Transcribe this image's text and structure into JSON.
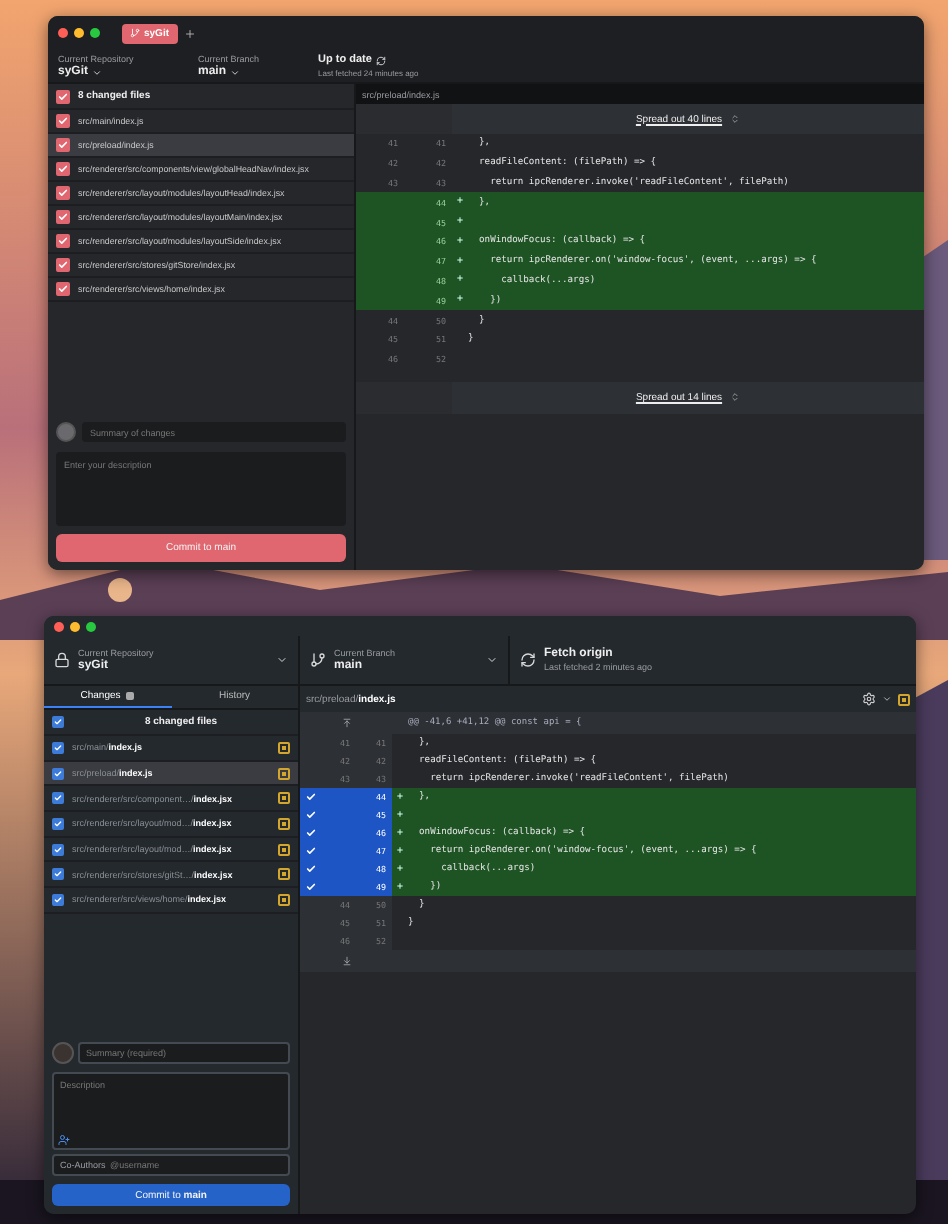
{
  "top_window": {
    "tab": {
      "label": "syGit"
    },
    "toolbar": [
      {
        "kind": "dropdown",
        "label": "Current Repository",
        "value": "syGit"
      },
      {
        "kind": "dropdown",
        "label": "Current Branch",
        "value": "main"
      },
      {
        "kind": "fetch",
        "label": "Up to date",
        "value": "Last fetched 24 minutes ago"
      }
    ],
    "changes": {
      "header": "8 changed files",
      "checked": true,
      "files": [
        {
          "path": "src/main/index.js",
          "checked": true,
          "selected": false
        },
        {
          "path": "src/preload/index.js",
          "checked": true,
          "selected": true
        },
        {
          "path": "src/renderer/src/components/view/globalHeadNav/index.jsx",
          "checked": true,
          "selected": false
        },
        {
          "path": "src/renderer/src/layout/modules/layoutHead/index.jsx",
          "checked": true,
          "selected": false
        },
        {
          "path": "src/renderer/src/layout/modules/layoutMain/index.jsx",
          "checked": true,
          "selected": false
        },
        {
          "path": "src/renderer/src/layout/modules/layoutSide/index.jsx",
          "checked": true,
          "selected": false
        },
        {
          "path": "src/renderer/src/stores/gitStore/index.jsx",
          "checked": true,
          "selected": false
        },
        {
          "path": "src/renderer/src/views/home/index.jsx",
          "checked": true,
          "selected": false
        }
      ]
    },
    "commit": {
      "summary_placeholder": "Summary of changes",
      "description_placeholder": "Enter your description",
      "button": "Commit to main"
    },
    "diff": {
      "path": "src/preload/index.js",
      "expand_top": "Spread out 40 lines",
      "expand_bottom": "Spread out 14 lines",
      "lines": [
        {
          "kind": "context",
          "old": "41",
          "new": "41",
          "code": "  },"
        },
        {
          "kind": "context",
          "old": "42",
          "new": "42",
          "code": "  readFileContent: (filePath) => {"
        },
        {
          "kind": "context",
          "old": "43",
          "new": "43",
          "code": "    return ipcRenderer.invoke('readFileContent', filePath)"
        },
        {
          "kind": "added",
          "new": "44",
          "code": "  },"
        },
        {
          "kind": "added",
          "new": "45"
        },
        {
          "kind": "added",
          "new": "46",
          "code": "  onWindowFocus: (callback) => {"
        },
        {
          "kind": "added",
          "new": "47",
          "code": "    return ipcRenderer.on('window-focus', (event, ...args) => {"
        },
        {
          "kind": "added",
          "new": "48",
          "code": "      callback(...args)"
        },
        {
          "kind": "added",
          "new": "49",
          "code": "    })"
        },
        {
          "kind": "context",
          "old": "44",
          "new": "50",
          "code": "  }"
        },
        {
          "kind": "context",
          "old": "45",
          "new": "51",
          "code": "}"
        },
        {
          "kind": "context",
          "old": "46",
          "new": "52"
        }
      ]
    }
  },
  "bottom_window": {
    "toolbar": [
      {
        "kind": "repository",
        "label": "Current Repository",
        "value": "syGit"
      },
      {
        "kind": "branch",
        "label": "Current Branch",
        "value": "main"
      },
      {
        "kind": "fetch",
        "label": "Fetch origin",
        "value": "Last fetched 2 minutes ago"
      }
    ],
    "tabs": [
      {
        "label": "Changes",
        "selected": true,
        "badge": true
      },
      {
        "label": "History",
        "selected": false,
        "badge": false
      }
    ],
    "changes": {
      "header": "8 changed files",
      "checked": true,
      "files": [
        {
          "path": "src/main/**index.js**",
          "checked": true,
          "selected": false
        },
        {
          "path": "src/preload/**index.js**",
          "checked": true,
          "selected": true
        },
        {
          "path": "src/renderer/src/component…/**index.jsx**",
          "checked": true,
          "selected": false
        },
        {
          "path": "src/renderer/src/layout/mod…/**index.jsx**",
          "checked": true,
          "selected": false
        },
        {
          "path": "src/renderer/src/layout/mod…/**index.jsx**",
          "checked": true,
          "selected": false
        },
        {
          "path": "src/renderer/src/stores/gitSt…/**index.jsx**",
          "checked": true,
          "selected": false
        },
        {
          "path": "src/renderer/src/views/home/**index.jsx**",
          "checked": true,
          "selected": false
        }
      ]
    },
    "commit": {
      "summary_placeholder": "Summary (required)",
      "description_placeholder": "Description",
      "coauthors": {
        "label": "Co-Authors",
        "placeholder": "@username"
      },
      "button": "Commit to **main**"
    },
    "diff": {
      "path": "src/preload/**index.js**",
      "hunk": "@@ -41,6 +41,12 @@ const api = {",
      "lines": [
        {
          "kind": "context",
          "old": "41",
          "new": "41",
          "code": "  },"
        },
        {
          "kind": "context",
          "old": "42",
          "new": "42",
          "code": "  readFileContent: (filePath) => {"
        },
        {
          "kind": "context",
          "old": "43",
          "new": "43",
          "code": "    return ipcRenderer.invoke('readFileContent', filePath)"
        },
        {
          "kind": "added",
          "new": "44",
          "code": "  },",
          "selected": true
        },
        {
          "kind": "added",
          "new": "45",
          "selected": true
        },
        {
          "kind": "added",
          "new": "46",
          "code": "  onWindowFocus: (callback) => {",
          "selected": true
        },
        {
          "kind": "added",
          "new": "47",
          "code": "    return ipcRenderer.on('window-focus', (event, ...args) => {",
          "selected": true
        },
        {
          "kind": "added",
          "new": "48",
          "code": "      callback(...args)",
          "selected": true
        },
        {
          "kind": "added",
          "new": "49",
          "code": "    })",
          "selected": true
        },
        {
          "kind": "context",
          "old": "44",
          "new": "50",
          "code": "  }"
        },
        {
          "kind": "context",
          "old": "45",
          "new": "51",
          "code": "}"
        },
        {
          "kind": "context",
          "old": "46",
          "new": "52"
        }
      ]
    }
  }
}
